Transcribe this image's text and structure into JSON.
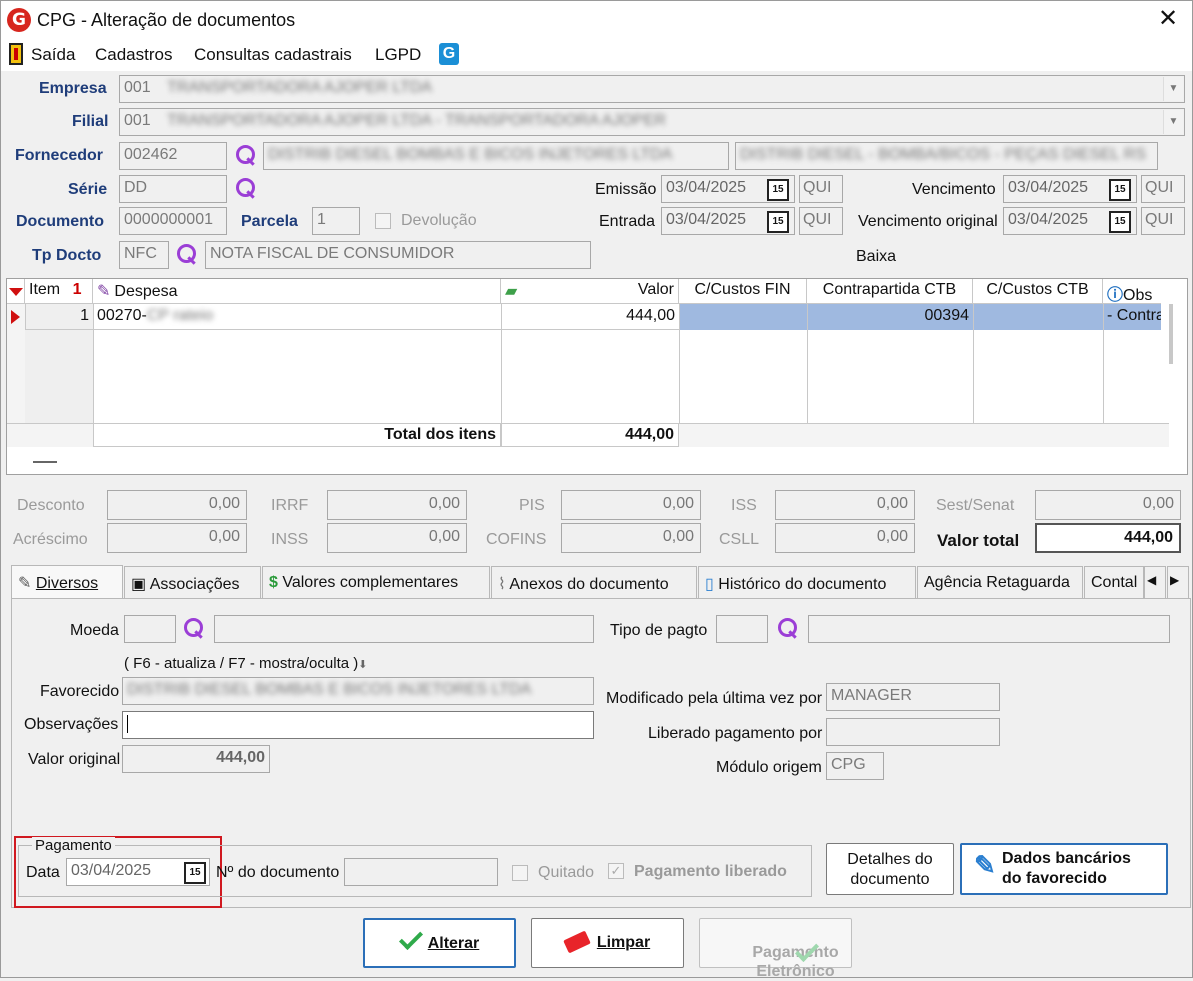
{
  "window": {
    "title": "CPG - Alteração de documentos",
    "close": "✕",
    "logo": "G"
  },
  "menu": {
    "items": [
      "Saída",
      "Cadastros",
      "Consultas cadastrais",
      "LGPD"
    ],
    "logo2": "G"
  },
  "header": {
    "empresa_label": "Empresa",
    "empresa_code": "001",
    "empresa_name": "TRANSPORTADORA AJOPER LTDA",
    "filial_label": "Filial",
    "filial_code": "001",
    "filial_name": "TRANSPORTADORA AJOPER LTDA - TRANSPORTADORA AJOPER",
    "fornecedor_label": "Fornecedor",
    "fornecedor_code": "002462",
    "fornecedor_name": "DISTRIB DIESEL BOMBAS E BICOS INJETORES LTDA",
    "fornecedor_name2": "DISTRIB DIESEL - BOMBA/BICOS - PEÇAS DIESEL RS",
    "serie_label": "Série",
    "serie_value": "DD",
    "documento_label": "Documento",
    "documento_value": "0000000001",
    "parcela_label": "Parcela",
    "parcela_value": "1",
    "devolucao_label": "Devolução",
    "tpdocto_label": "Tp Docto",
    "tpdocto_code": "NFC",
    "tpdocto_desc": "NOTA FISCAL DE CONSUMIDOR",
    "emissao_label": "Emissão",
    "emissao_value": "03/04/2025",
    "emissao_day": "QUI",
    "entrada_label": "Entrada",
    "entrada_value": "03/04/2025",
    "entrada_day": "QUI",
    "vencimento_label": "Vencimento",
    "vencimento_value": "03/04/2025",
    "vencimento_day": "QUI",
    "vencorig_label": "Vencimento original",
    "vencorig_value": "03/04/2025",
    "vencorig_day": "QUI",
    "baixa_label": "Baixa",
    "cal_glyph": "15"
  },
  "grid": {
    "headers": {
      "item": "Item",
      "item_mark": "1",
      "despesa": "Despesa",
      "valor": "Valor",
      "ccfin": "C/Custos FIN",
      "contrapartida": "Contrapartida CTB",
      "ccctb": "C/Custos CTB",
      "obs": "Obs"
    },
    "rows": [
      {
        "item": "1",
        "despesa_code": "00270-",
        "despesa_name": "CP rateio",
        "valor": "444,00",
        "contrapartida": "00394",
        "obs": "- Contra"
      }
    ],
    "total_label": "Total dos itens",
    "total_value": "444,00"
  },
  "summary": {
    "desconto_label": "Desconto",
    "desconto": "0,00",
    "irrf_label": "IRRF",
    "irrf": "0,00",
    "pis_label": "PIS",
    "pis": "0,00",
    "iss_label": "ISS",
    "iss": "0,00",
    "sest_label": "Sest/Senat",
    "sest": "0,00",
    "acrescimo_label": "Acréscimo",
    "acrescimo": "0,00",
    "inss_label": "INSS",
    "inss": "0,00",
    "cofins_label": "COFINS",
    "cofins": "0,00",
    "csll_label": "CSLL",
    "csll": "0,00",
    "valortotal_label": "Valor total",
    "valortotal": "444,00"
  },
  "tabs": [
    "Diversos",
    "Associações",
    "Valores complementares",
    "Anexos do documento",
    "Histórico do documento",
    "Agência Retaguarda",
    "Contal"
  ],
  "tab_nav": {
    "prev": "◀",
    "next": "▶"
  },
  "diversos": {
    "moeda_label": "Moeda",
    "tipopagto_label": "Tipo de pagto",
    "hint": "( F6 - atualiza / F7 - mostra/oculta )",
    "favorecido_label": "Favorecido",
    "favorecido_value": "DISTRIB DIESEL BOMBAS E BICOS INJETORES LTDA",
    "observacoes_label": "Observações",
    "valororiginal_label": "Valor original",
    "valororiginal": "444,00",
    "modificado_label": "Modificado pela última vez por",
    "modificado_value": "MANAGER",
    "liberado_label": "Liberado pagamento por",
    "modulo_label": "Módulo origem",
    "modulo_value": "CPG",
    "pagamento_legend": "Pagamento",
    "data_label": "Data",
    "data_value": "03/04/2025",
    "ndoc_label": "Nº do documento",
    "quitado_label": "Quitado",
    "pagliberado_label": "Pagamento liberado",
    "detalhes_line1": "Detalhes do",
    "detalhes_line2": "documento",
    "dados_line1": "Dados bancários",
    "dados_line2": "do favorecido"
  },
  "buttons": {
    "alterar": "Alterar",
    "limpar": "Limpar",
    "pageletr_line1": "Pagamento",
    "pageletr_line2": "Eletrônico"
  },
  "colors": {
    "accent_blue": "#1f3d7a",
    "selection": "#9fb9e0",
    "highlight_border": "#d0181f",
    "ok_green": "#2faa4a"
  }
}
